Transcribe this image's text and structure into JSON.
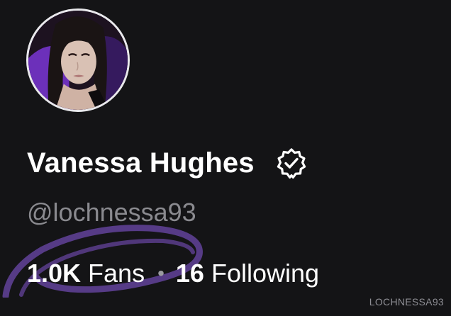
{
  "profile": {
    "display_name": "Vanessa Hughes",
    "handle": "@lochnessa93",
    "avatar": "profile-photo",
    "verified_icon": "verified-badge-icon"
  },
  "stats": {
    "fans_count": "1.0K",
    "fans_label": "Fans",
    "separator": "•",
    "following_count": "16",
    "following_label": "Following"
  },
  "watermark": "LOCHNESSA93",
  "colors": {
    "background": "#141416",
    "primary_text": "#ffffff",
    "secondary_text": "#8a8a8f",
    "annotation_scribble": "#5a3d8c",
    "avatar_border": "#e9e9ec"
  }
}
